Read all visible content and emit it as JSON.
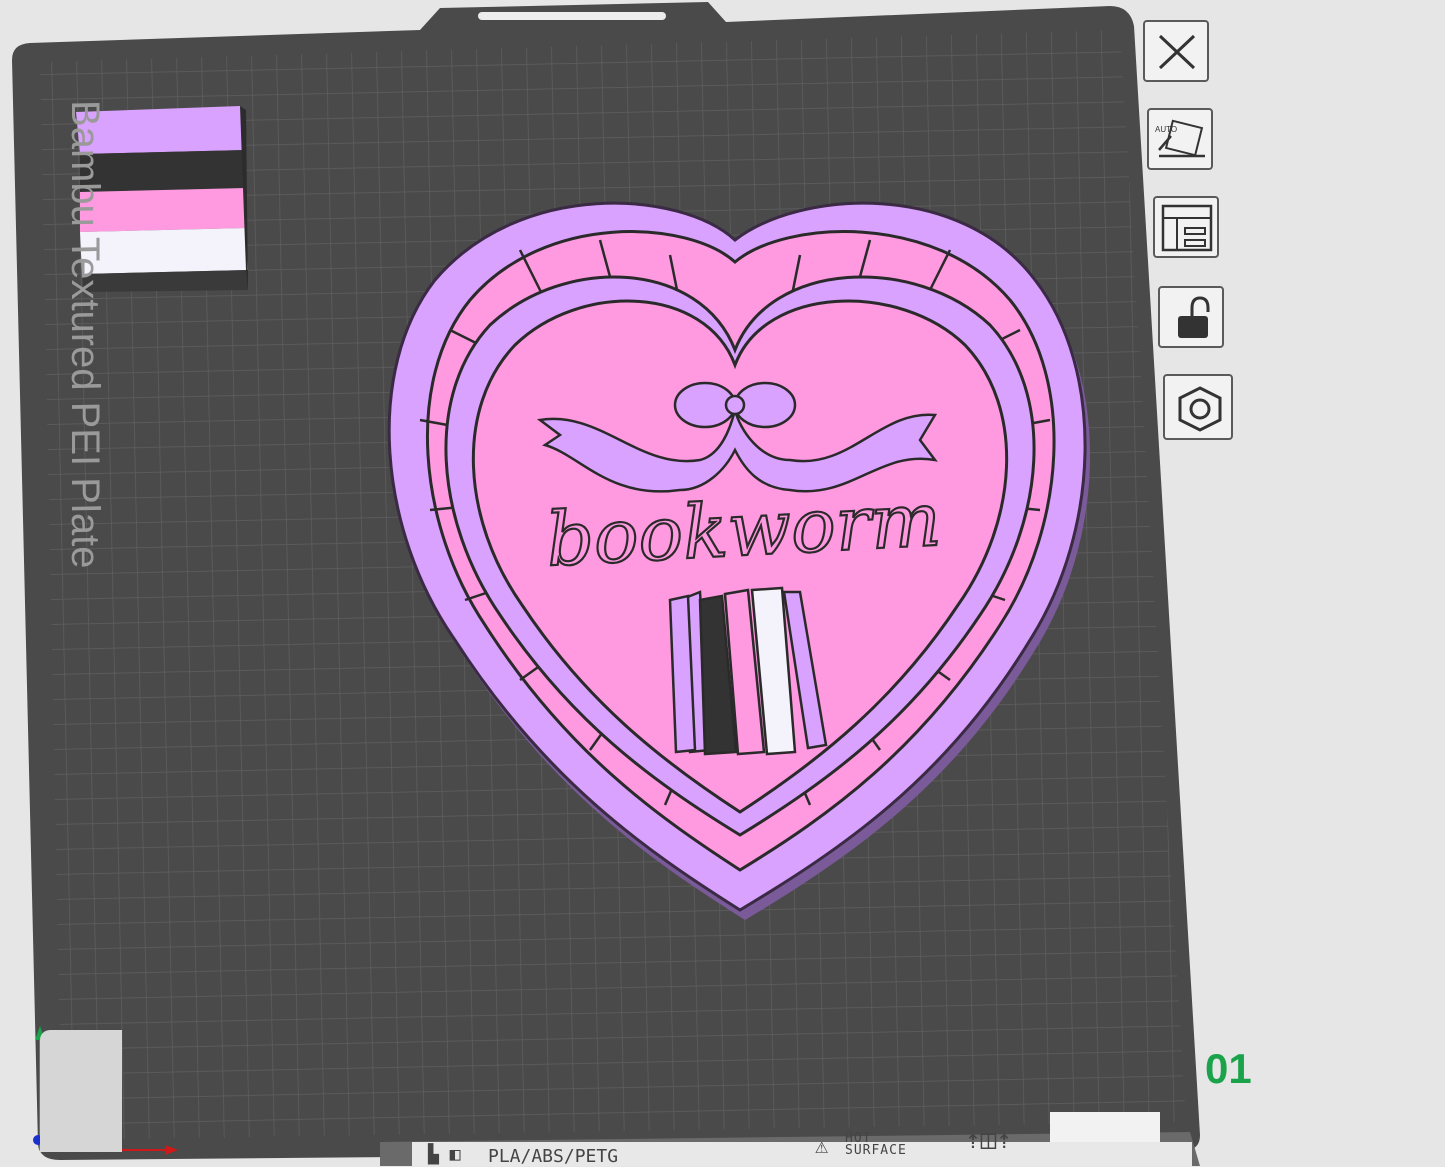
{
  "plate": {
    "label": "Bambu Textured PEI Plate",
    "number": "01",
    "bottom_bar": {
      "materials": "PLA/ABS/PETG",
      "hot_line1": "HOT",
      "hot_line2": "SURFACE"
    }
  },
  "model": {
    "text": "bookworm",
    "flag_colors": [
      "#d9a2ff",
      "#333333",
      "#ff9ae0",
      "#f4f2fa"
    ]
  },
  "toolbar": {
    "close_icon": "close-icon",
    "auto_orient_icon": "auto-orient-icon",
    "auto_orient_label": "AUTO",
    "arrange_icon": "arrange-layout-icon",
    "lock_icon": "unlock-icon",
    "settings_icon": "hex-nut-icon"
  },
  "colors": {
    "plate": "#4a4a4a",
    "grid": "#5c5c5c",
    "accent_green": "#1aa34a",
    "purple": "#d9a2ff",
    "pink": "#ff9ae0"
  }
}
